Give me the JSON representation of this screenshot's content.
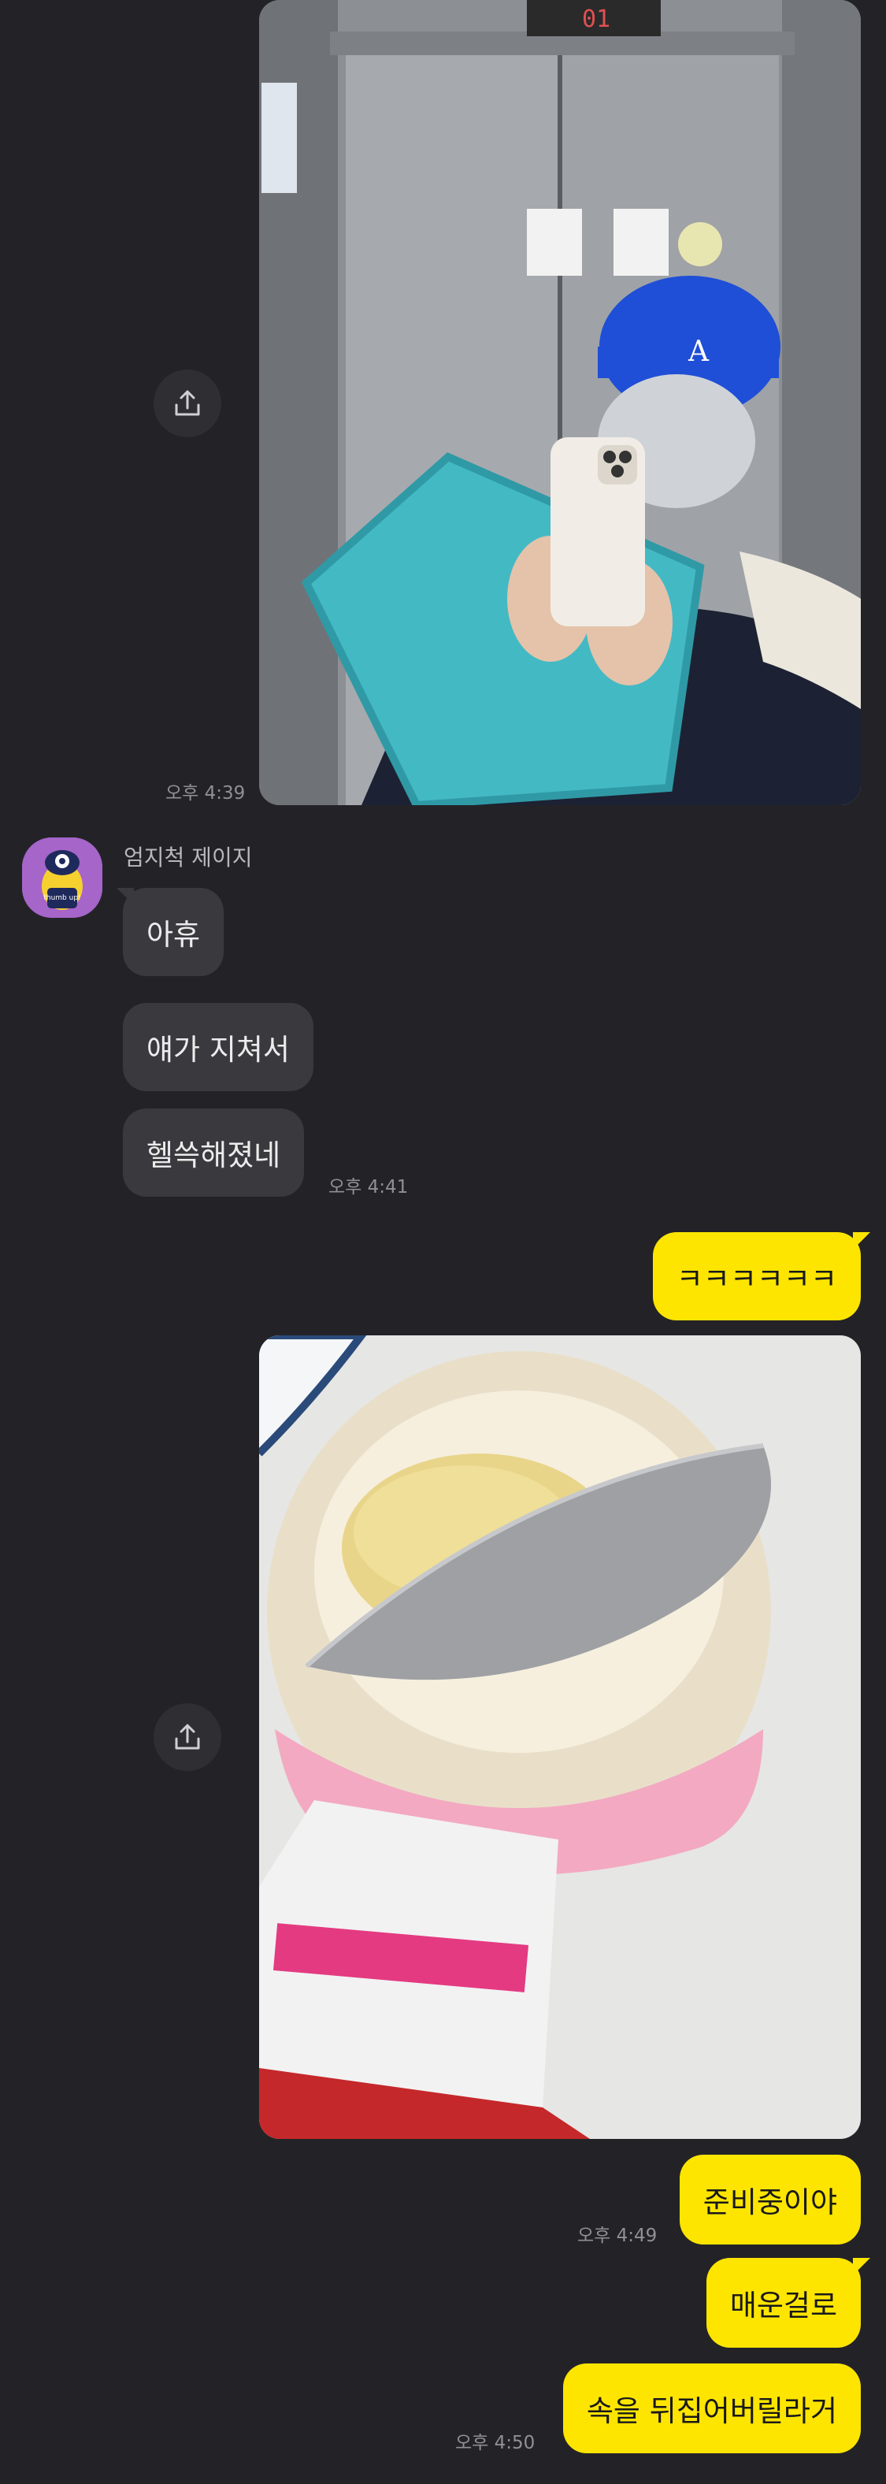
{
  "colors": {
    "background": "#232327",
    "sent_bubble": "#fde500",
    "received_bubble": "#3a3a3e",
    "timestamp": "#8f8f95"
  },
  "messages": {
    "photo1": {
      "time": "오후 4:39",
      "share_icon": "share-icon"
    },
    "sender": {
      "name": "엄지척 제이지",
      "avatar_text": "thumb up!"
    },
    "received": [
      {
        "text": "아휴"
      },
      {
        "text": "얘가 지쳐서"
      },
      {
        "text": "헬쓱해졌네",
        "time": "오후 4:41"
      }
    ],
    "sent1": {
      "text": "ㅋㅋㅋㅋㅋㅋ"
    },
    "photo2": {
      "share_icon": "share-icon"
    },
    "sent2": [
      {
        "text": "준비중이야",
        "time": "오후 4:49"
      },
      {
        "text": "매운걸로"
      },
      {
        "text": "속을 뒤집어버릴라거",
        "time": "오후 4:50"
      }
    ]
  }
}
